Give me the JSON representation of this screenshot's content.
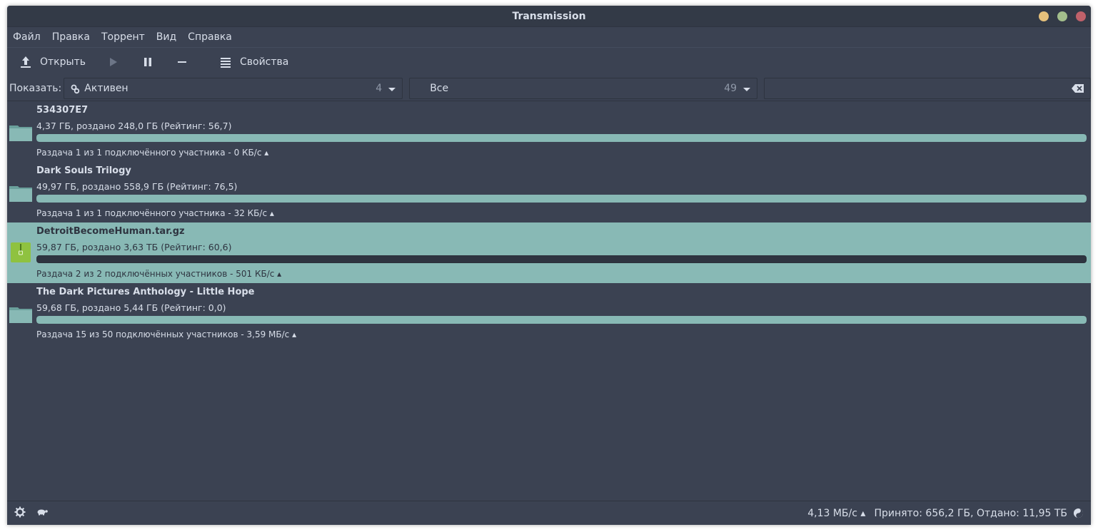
{
  "window": {
    "title": "Transmission",
    "controls": {
      "minimize_color": "#e5c07b",
      "maximize_color": "#a3be8c",
      "close_color": "#bf616a"
    }
  },
  "menu": [
    "Файл",
    "Правка",
    "Торрент",
    "Вид",
    "Справка"
  ],
  "toolbar": {
    "open_label": "Открыть",
    "properties_label": "Свойства",
    "icons": [
      "upload-icon",
      "play-icon",
      "pause-icon",
      "remove-icon",
      "list-icon"
    ]
  },
  "filter": {
    "show_label": "Показать:",
    "activity": {
      "value": "Активен",
      "count": "4",
      "icon": "gears-icon"
    },
    "category": {
      "value": "Все",
      "count": "49"
    },
    "search": {
      "value": "",
      "clear_icon": "clear-backspace-icon"
    }
  },
  "torrents": [
    {
      "name": "534307E7",
      "size": "4,37 ГБ, роздано 248,0 ГБ (Рейтинг: 56,7)",
      "progress": 1.0,
      "status": "Раздача 1 из 1 подключённого участника - 0 КБ/с ▴",
      "icon": "folder-icon",
      "selected": false
    },
    {
      "name": "Dark Souls Trilogy",
      "size": "49,97 ГБ, роздано 558,9 ГБ (Рейтинг: 76,5)",
      "progress": 1.0,
      "status": "Раздача 1 из 1 подключённого участника - 32 КБ/с ▴",
      "icon": "folder-icon",
      "selected": false
    },
    {
      "name": "DetroitBecomeHuman.tar.gz",
      "size": "59,87 ГБ, роздано 3,63 ТБ (Рейтинг: 60,6)",
      "progress": 1.0,
      "status": "Раздача 2 из 2 подключённых участников - 501 КБ/с ▴",
      "icon": "archive-icon",
      "selected": true
    },
    {
      "name": "The Dark Pictures Anthology - Little Hope",
      "size": "59,68 ГБ, роздано 5,44 ГБ (Рейтинг: 0,0)",
      "progress": 1.0,
      "status": "Раздача 15 из 50 подключённых участников - 3,59 МБ/с ▴",
      "icon": "folder-icon",
      "selected": false
    }
  ],
  "statusbar": {
    "speed": "4,13 МБ/с ▴",
    "totals": "Принято: 656,2 ГБ, Отдано: 11,95 ТБ",
    "left_icons": [
      "settings-gear-icon",
      "turtle-speed-limit-icon"
    ],
    "ratio_icon": "ratio-yin-yang-icon"
  },
  "colors": {
    "background": "#3b4252",
    "accent": "#88b9b5",
    "text": "#d8dee9",
    "archive_icon": "#8fc240"
  }
}
